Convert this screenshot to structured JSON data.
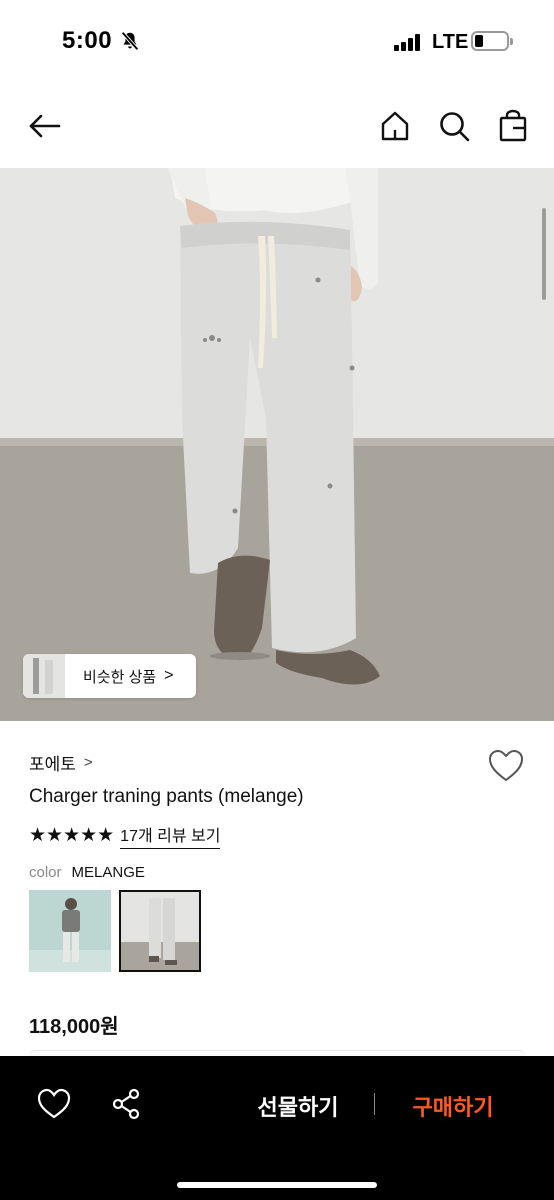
{
  "status_bar": {
    "time": "5:00",
    "network": "LTE",
    "icons": [
      "bell-slash-icon",
      "signal-bars-icon",
      "battery-icon"
    ]
  },
  "top_nav": {
    "icons": [
      "back-arrow-icon",
      "home-icon",
      "search-icon",
      "shopping-bag-icon"
    ]
  },
  "product": {
    "image_icon": "product-photo",
    "similar_label": "비슷한 상품",
    "similar_arrow": ">",
    "brand": "포에토",
    "brand_arrow": ">",
    "title": "Charger traning pants (melange)",
    "stars": "★★★★★",
    "rating": 5,
    "review_link": "17개 리뷰 보기",
    "option_key": "color",
    "option_value": "MELANGE",
    "price": "118,000원",
    "swatch_selected_index": 1
  },
  "bottom_bar": {
    "gift_label": "선물하기",
    "buy_label": "구매하기",
    "buy_color": "#ff5a1f",
    "icons": [
      "heart-icon",
      "share-icon"
    ]
  }
}
